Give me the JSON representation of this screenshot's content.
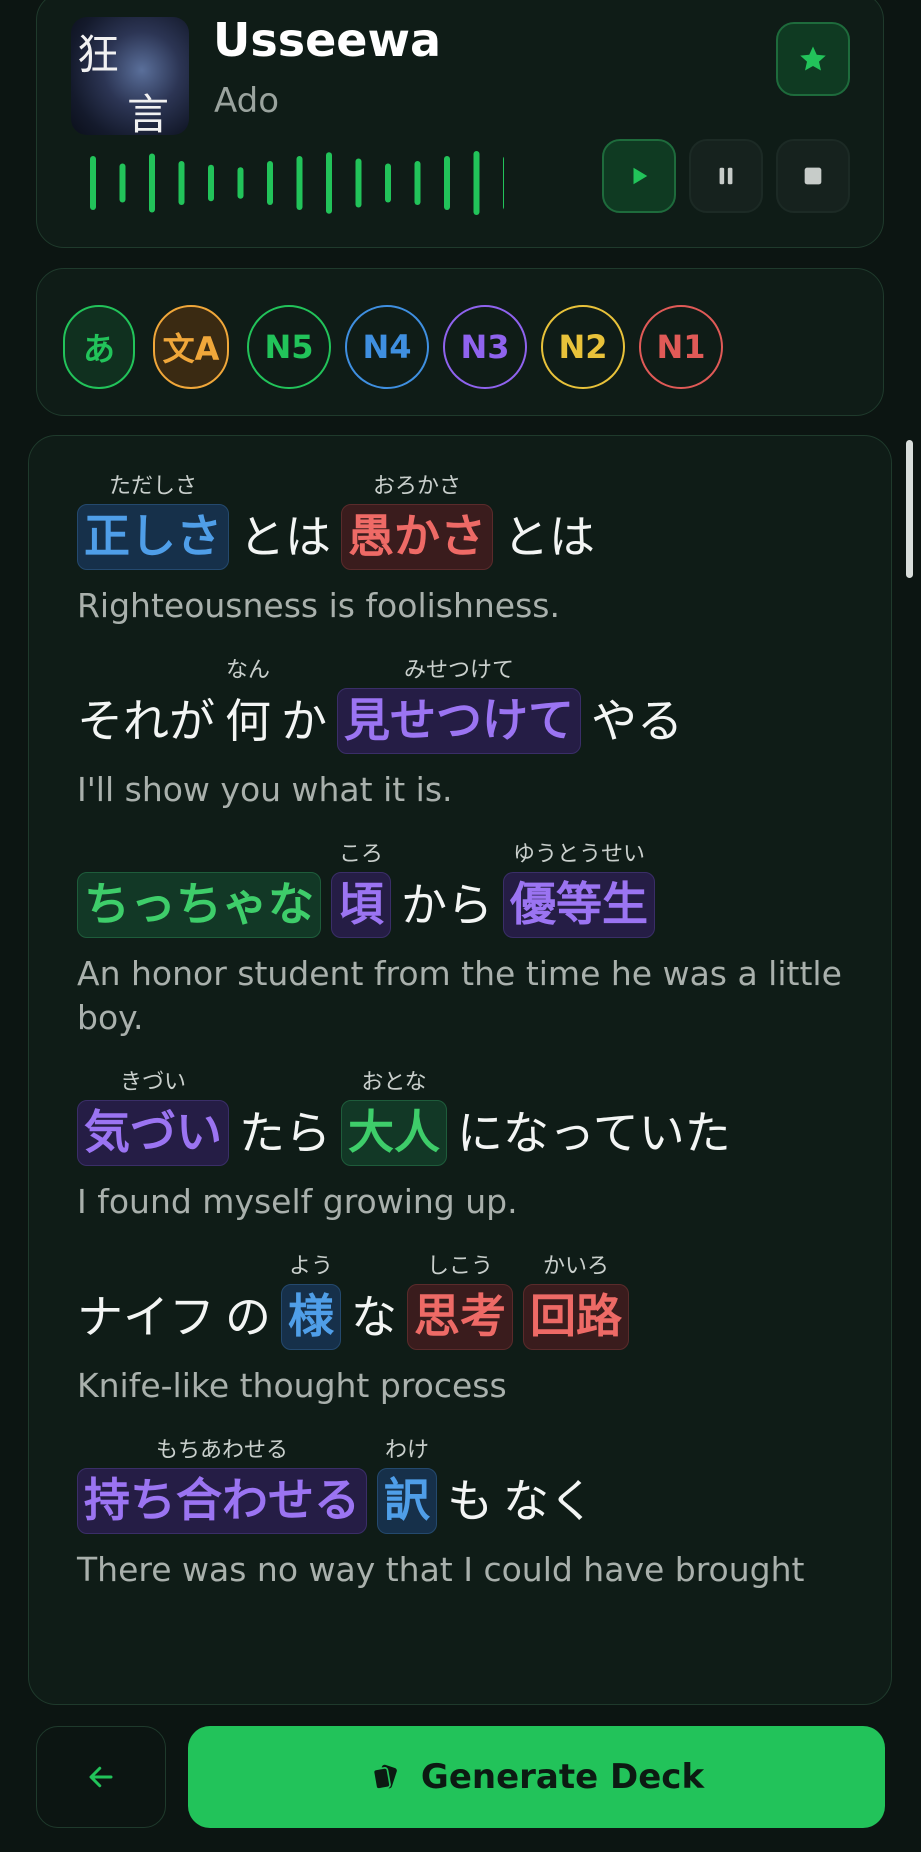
{
  "player": {
    "title": "Usseewa",
    "artist": "Ado",
    "cover_text_1": "狂",
    "cover_text_2": "言",
    "favorite_icon": "star-icon",
    "controls": [
      "play-icon",
      "pause-icon",
      "stop-icon"
    ],
    "waveform_levels": [
      0.8,
      0.5,
      0.9,
      0.6,
      0.45,
      0.35,
      0.6,
      0.8,
      0.95,
      0.7,
      0.5,
      0.6,
      0.8,
      1.0,
      0.8
    ],
    "accent": "#22c35a"
  },
  "levels": [
    {
      "label": "あ",
      "color": "#22c35a",
      "bg": "#10301f"
    },
    {
      "label": "文A",
      "color": "#f0a73a",
      "bg": "#3a2a12"
    },
    {
      "label": "N5",
      "color": "#22c35a",
      "bg": "#0f1c17"
    },
    {
      "label": "N4",
      "color": "#3f8fe0",
      "bg": "#0f1c17"
    },
    {
      "label": "N3",
      "color": "#8f63ee",
      "bg": "#0f1c17"
    },
    {
      "label": "N2",
      "color": "#e8c23a",
      "bg": "#0f1c17"
    },
    {
      "label": "N1",
      "color": "#e05a57",
      "bg": "#0f1c17"
    }
  ],
  "lyrics": [
    {
      "segments": [
        {
          "text": "正しさ",
          "ruby": "ただしさ",
          "cls": "blue"
        },
        {
          "text": "とは"
        },
        {
          "text": "愚かさ",
          "ruby": "おろかさ",
          "cls": "red"
        },
        {
          "text": "とは"
        }
      ],
      "translation": "Righteousness is foolishness."
    },
    {
      "segments": [
        {
          "text": "それが"
        },
        {
          "text": "何",
          "ruby": "なん"
        },
        {
          "text": "か"
        },
        {
          "text": "見せつけて",
          "ruby": "みせつけて",
          "cls": "purple"
        },
        {
          "text": "やる"
        }
      ],
      "translation": "I'll show you what it is."
    },
    {
      "segments": [
        {
          "text": "ちっちゃな",
          "cls": "green"
        },
        {
          "text": "頃",
          "ruby": "ころ",
          "cls": "purple"
        },
        {
          "text": "から"
        },
        {
          "text": "優等生",
          "ruby": "ゆうとうせい",
          "cls": "purple"
        }
      ],
      "translation": "An honor student from the time he was a little boy."
    },
    {
      "segments": [
        {
          "text": "気づい",
          "ruby": "きづい",
          "cls": "purple"
        },
        {
          "text": "たら"
        },
        {
          "text": "大人",
          "ruby": "おとな",
          "cls": "green"
        },
        {
          "text": "になっていた"
        }
      ],
      "translation": "I found myself growing up."
    },
    {
      "segments": [
        {
          "text": "ナイフ"
        },
        {
          "text": "の"
        },
        {
          "text": "様",
          "ruby": "よう",
          "cls": "blue"
        },
        {
          "text": "な"
        },
        {
          "text": "思考",
          "ruby": "しこう",
          "cls": "red"
        },
        {
          "text": "回路",
          "ruby": "かいろ",
          "cls": "red"
        }
      ],
      "translation": "Knife-like thought process"
    },
    {
      "segments": [
        {
          "text": "持ち合わせる",
          "ruby": "もちあわせる",
          "cls": "purple"
        },
        {
          "text": "訳",
          "ruby": "わけ",
          "cls": "blue"
        },
        {
          "text": "も"
        },
        {
          "text": "なく"
        }
      ],
      "translation": "There was no way that I could have brought"
    }
  ],
  "footer": {
    "back_icon": "arrow-left-icon",
    "generate_label": "Generate Deck",
    "generate_icon": "cards-icon"
  }
}
